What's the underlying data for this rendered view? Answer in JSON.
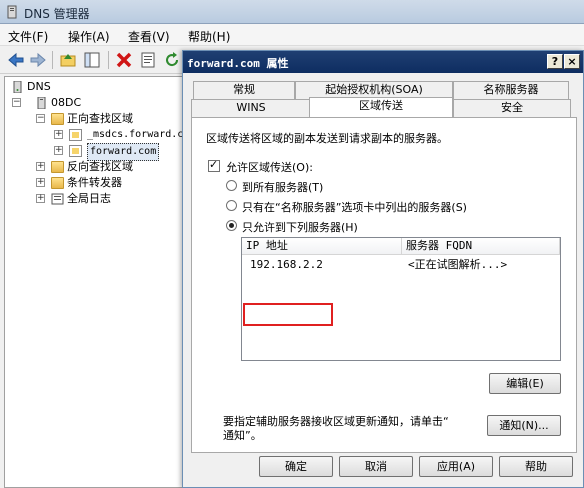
{
  "main_window": {
    "title": "DNS 管理器",
    "menu": [
      "文件(F)",
      "操作(A)",
      "查看(V)",
      "帮助(H)"
    ],
    "tree": {
      "root": "DNS",
      "server": "08DC",
      "items": [
        "正向查找区域",
        "_msdcs.forward.c",
        "forward.com",
        "反向查找区域",
        "条件转发器",
        "全局日志"
      ]
    }
  },
  "dialog": {
    "title": "forward.com 属性",
    "help_button": "?",
    "close_button": "×",
    "tabs_row1": [
      "常规",
      "起始授权机构(SOA)",
      "名称服务器"
    ],
    "tabs_row2": [
      "WINS",
      "区域传送",
      "安全"
    ],
    "active_tab": "区域传送",
    "description": "区域传送将区域的副本发送到请求副本的服务器。",
    "allow_transfer": {
      "label": "允许区域传送(O):",
      "checked": true
    },
    "radio_options": [
      {
        "label": "到所有服务器(T)",
        "selected": false
      },
      {
        "label": "只有在“名称服务器”选项卡中列出的服务器(S)",
        "selected": false
      },
      {
        "label": "只允许到下列服务器(H)",
        "selected": true
      }
    ],
    "server_list": {
      "columns": [
        "IP 地址",
        "服务器 FQDN"
      ],
      "rows": [
        {
          "ip": "192.168.2.2",
          "fqdn": "<正在试图解析...>"
        }
      ]
    },
    "edit_button": "编辑(E)",
    "notify_text_line1": "要指定辅助服务器接收区域更新通知，请单击“",
    "notify_text_line2": "通知”。",
    "notify_button": "通知(N)...",
    "buttons": {
      "ok": "确定",
      "cancel": "取消",
      "apply": "应用(A)",
      "help": "帮助"
    }
  },
  "colors": {
    "dialog_title_bg": "#0e2d61",
    "highlight_box": "#e02020"
  }
}
